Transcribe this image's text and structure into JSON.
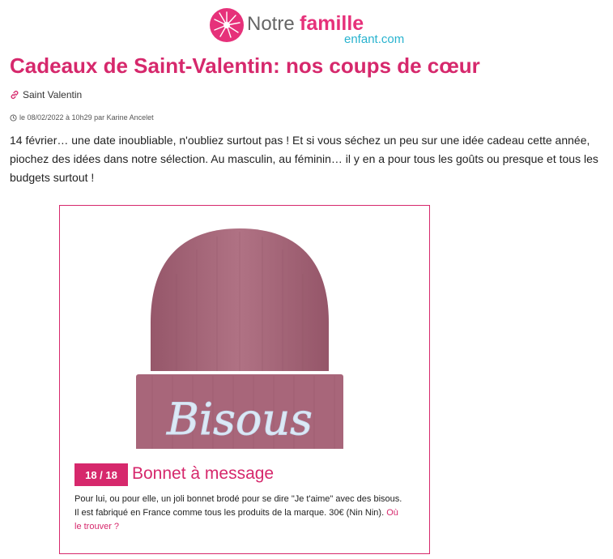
{
  "brand": {
    "logo_word1": "Notre",
    "logo_word2": "famille",
    "logo_sub": "enfant.com",
    "color_primary": "#d6286c",
    "color_secondary": "#29b3cf"
  },
  "article": {
    "title": "Cadeaux de Saint-Valentin: nos coups de cœur",
    "category": "Saint Valentin",
    "category_icon": "link-icon",
    "meta": "le 08/02/2022 à 10h29 par Karine Ancelet",
    "meta_icon": "clock-icon",
    "intro": "14 février… une date inoubliable, n'oubliez surtout pas ! Et si vous séchez un peu sur une idée cadeau cette année, piochez des idées dans notre sélection. Au masculin, au féminin… il y en a pour tous les goûts ou presque et tous les budgets surtout !"
  },
  "slide": {
    "counter": "18 / 18",
    "title": "Bonnet à message",
    "image_text": "Bisous",
    "image_color": "#a8667a",
    "description": "Pour lui, ou pour elle, un joli bonnet brodé pour se dire \"Je t'aime\" avec des bisous. Il est fabriqué en France comme tous les produits de la marque. 30€ (Nin Nin).",
    "link_label": "Où le trouver ?"
  }
}
